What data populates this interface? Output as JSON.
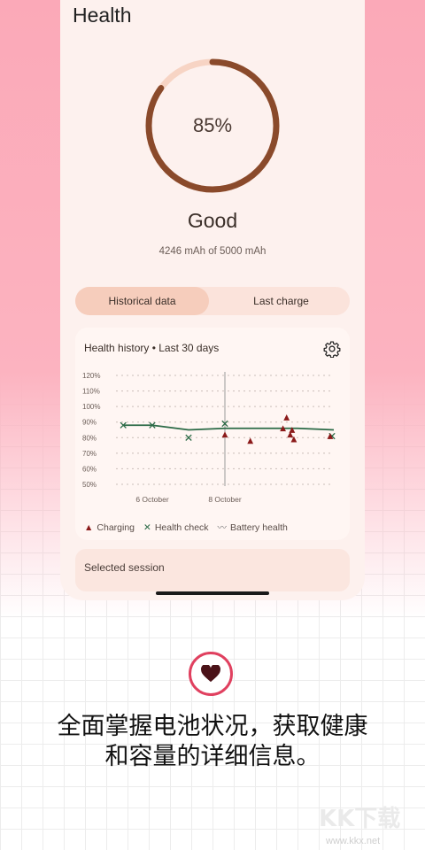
{
  "screen": {
    "title": "Health",
    "battery_health_percent": 85,
    "battery_health_text": "85%",
    "status": "Good",
    "capacity_text": "4246 mAh of 5000 mAh"
  },
  "tabs": [
    {
      "label": "Historical data",
      "active": true
    },
    {
      "label": "Last charge",
      "active": false
    }
  ],
  "history_card": {
    "title": "Health history • Last 30 days",
    "settings_icon": "gear-icon"
  },
  "chart_data": {
    "type": "scatter",
    "title": "",
    "ylim": [
      50,
      120
    ],
    "yticks": [
      "120%",
      "110%",
      "100%",
      "90%",
      "80%",
      "70%",
      "60%",
      "50%"
    ],
    "xtick_labels": [
      "6 October",
      "8 October"
    ],
    "series": [
      {
        "name": "Charging",
        "marker": "triangle",
        "color": "#8b1a1a",
        "points": [
          [
            3.0,
            82
          ],
          [
            3.7,
            78
          ],
          [
            4.6,
            86
          ],
          [
            4.7,
            93
          ],
          [
            4.8,
            82
          ],
          [
            4.85,
            85
          ],
          [
            4.9,
            79
          ],
          [
            5.9,
            81
          ]
        ]
      },
      {
        "name": "Health check",
        "marker": "x",
        "color": "#2b6a46",
        "points": [
          [
            0.2,
            88
          ],
          [
            1.0,
            88
          ],
          [
            2.0,
            80
          ],
          [
            3.0,
            89
          ],
          [
            5.95,
            81
          ]
        ]
      },
      {
        "name": "Battery health",
        "marker": "line",
        "color": "#2b6a46",
        "points": [
          [
            0.2,
            88
          ],
          [
            1.0,
            88
          ],
          [
            2.0,
            85
          ],
          [
            3.0,
            86
          ],
          [
            4.0,
            86
          ],
          [
            5.0,
            86
          ],
          [
            6.0,
            85
          ]
        ]
      }
    ]
  },
  "legend": {
    "charging": "Charging",
    "health_check": "Health check",
    "battery_health": "Battery health"
  },
  "session": {
    "label": "Selected session"
  },
  "promo": {
    "icon": "heart-icon",
    "line1": "全面掌握电池状况，获取健康",
    "line2": "和容量的详细信息。"
  },
  "watermark": {
    "text": "KK下载",
    "url": "www.kkx.net"
  },
  "colors": {
    "ring_fill": "#8a4a2b",
    "ring_track": "#f7d4c4",
    "accent": "#e0405f",
    "chart_green": "#2b6a46",
    "chart_red": "#8b1a1a"
  }
}
